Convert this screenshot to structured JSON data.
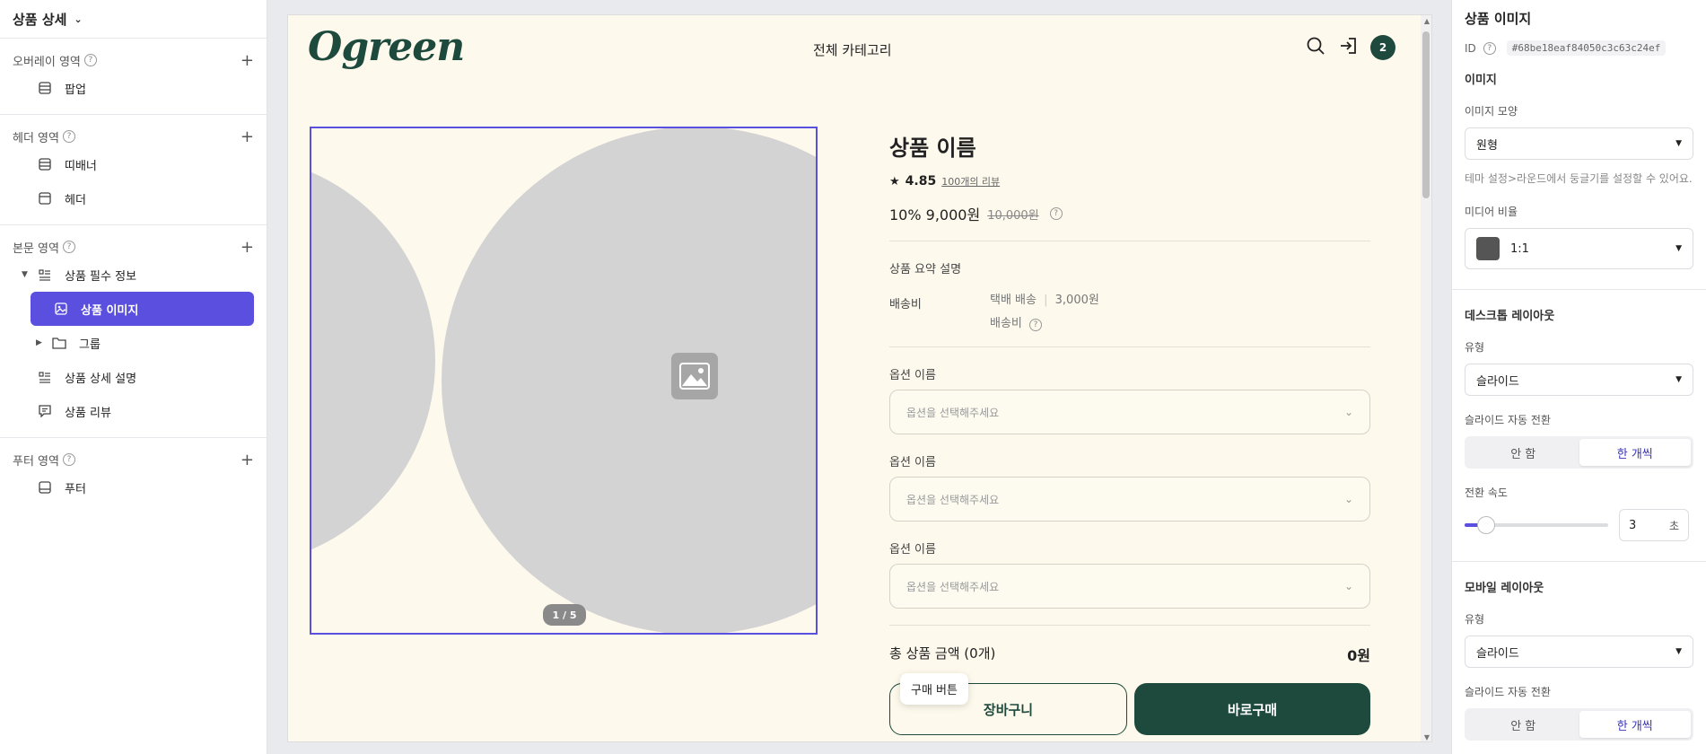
{
  "left": {
    "title": "상품 상세",
    "sections": [
      {
        "label": "오버레이 영역",
        "items": [
          {
            "label": "팝업"
          }
        ]
      },
      {
        "label": "헤더 영역",
        "items": [
          {
            "label": "띠배너"
          },
          {
            "label": "헤더"
          }
        ]
      },
      {
        "label": "본문 영역",
        "items": [
          {
            "label": "상품 필수 정보"
          },
          {
            "label": "상품 이미지"
          },
          {
            "label": "그룹"
          },
          {
            "label": "상품 상세 설명"
          },
          {
            "label": "상품 리뷰"
          }
        ]
      },
      {
        "label": "푸터 영역",
        "items": [
          {
            "label": "푸터"
          }
        ]
      }
    ]
  },
  "canvas": {
    "logo": "Ogreen",
    "nav": "전체 카테고리",
    "cart_count": "2",
    "gallery_counter": "1 / 5",
    "product": {
      "name": "상품 이름",
      "rating": "4.85",
      "reviews": "100개의 리뷰",
      "discount_price": "10% 9,000원",
      "original_price": "10,000원",
      "summary": "상품 요약 설명",
      "shipping_label": "배송비",
      "shipping_method": "택배 배송",
      "shipping_sep": "|",
      "shipping_cost": "3,000원",
      "shipping_note": "배송비",
      "options": [
        {
          "label": "옵션 이름",
          "placeholder": "옵션을 선택해주세요"
        },
        {
          "label": "옵션 이름",
          "placeholder": "옵션을 선택해주세요"
        },
        {
          "label": "옵션 이름",
          "placeholder": "옵션을 선택해주세요"
        }
      ],
      "total_label": "총 상품 금액 (0개)",
      "total_value": "0원",
      "cart_button": "장바구니",
      "buy_button": "바로구매",
      "tooltip": "구매 버튼"
    }
  },
  "right": {
    "title": "상품 이미지",
    "id_label": "ID",
    "id_value": "#68be18eaf84050c3c63c24ef",
    "image_section": "이미지",
    "image_shape_label": "이미지 모양",
    "image_shape_value": "원형",
    "hint": "테마 설정>라운드에서 둥글기를 설정할 수 있어요.",
    "media_ratio_label": "미디어 비율",
    "media_ratio_value": "1:1",
    "desktop_section": "데스크톱 레이아웃",
    "desktop_type_label": "유형",
    "desktop_type_value": "슬라이드",
    "desktop_auto_label": "슬라이드 자동 전환",
    "seg_off": "안 함",
    "seg_on": "한 개씩",
    "speed_label": "전환 속도",
    "speed_value": "3",
    "speed_unit": "초",
    "speed_level": 0.15,
    "mobile_section": "모바일 레이아웃",
    "mobile_type_label": "유형",
    "mobile_type_value": "슬라이드",
    "mobile_auto_label": "슬라이드 자동 전환",
    "colors": {
      "accent": "#5b4fe0",
      "brand": "#1d4a3c",
      "canvas_bg": "#fdf9ec"
    }
  }
}
